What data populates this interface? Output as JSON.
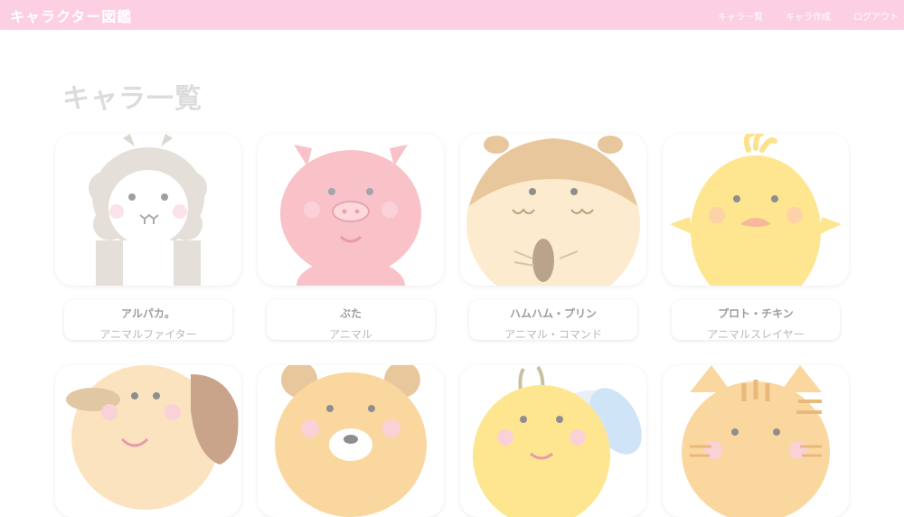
{
  "header": {
    "brand": "キャラクター図鑑",
    "nav": [
      "キャラ一覧",
      "キャラ作成",
      "ログアウト"
    ]
  },
  "main": {
    "title": "キャラ一覧",
    "cards": [
      {
        "name": "アルパカ。",
        "job": "アニマルファイター",
        "icon": "alpaca-icon"
      },
      {
        "name": "ぶた",
        "job": "アニマル",
        "icon": "pig-icon"
      },
      {
        "name": "ハムハム・プリン",
        "job": "アニマル・コマンド",
        "icon": "hamster-icon"
      },
      {
        "name": "プロト・チキン",
        "job": "アニマルスレイヤー",
        "icon": "chick-icon"
      },
      {
        "icon": "dog-icon"
      },
      {
        "icon": "bear-icon"
      },
      {
        "icon": "bee-icon"
      },
      {
        "icon": "cat-icon"
      }
    ]
  }
}
